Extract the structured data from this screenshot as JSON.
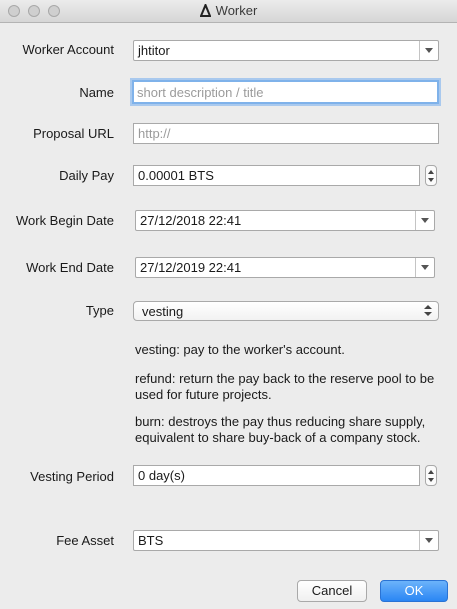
{
  "window": {
    "title": "Worker"
  },
  "fields": {
    "worker_account": {
      "label": "Worker Account",
      "value": "jhtitor"
    },
    "name": {
      "label": "Name",
      "value": "",
      "placeholder": "short description / title"
    },
    "proposal_url": {
      "label": "Proposal URL",
      "value": "",
      "placeholder": "http://"
    },
    "daily_pay": {
      "label": "Daily Pay",
      "value": "0.00001 BTS"
    },
    "work_begin_date": {
      "label": "Work Begin Date",
      "value": "27/12/2018 22:41"
    },
    "work_end_date": {
      "label": "Work End Date",
      "value": "27/12/2019 22:41"
    },
    "type": {
      "label": "Type",
      "value": "vesting"
    },
    "vesting_period": {
      "label": "Vesting Period",
      "value": "0 day(s)"
    },
    "fee_asset": {
      "label": "Fee Asset",
      "value": "BTS"
    }
  },
  "type_help": {
    "vesting": "vesting: pay to the worker's account.",
    "refund": "refund: return the pay back to the reserve pool to be used for future projects.",
    "burn": "burn: destroys the pay thus reducing share supply, equivalent to share buy-back of a company stock."
  },
  "buttons": {
    "cancel": "Cancel",
    "ok": "OK"
  },
  "colors": {
    "accent": "#2a86f4",
    "focus_ring": "#7fb2ea"
  }
}
